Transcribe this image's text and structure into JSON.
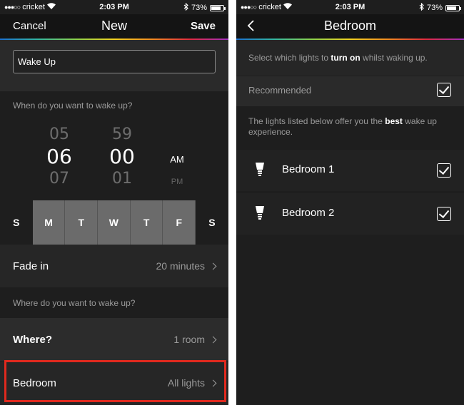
{
  "status": {
    "carrier": "cricket",
    "time": "2:03 PM",
    "battery": "73%"
  },
  "left": {
    "nav": {
      "cancel": "Cancel",
      "title": "New",
      "save": "Save"
    },
    "name_value": "Wake Up",
    "time_question": "When do you want to wake up?",
    "picker": {
      "hour_prev": "05",
      "hour": "06",
      "hour_next": "07",
      "minute_prev": "59",
      "minute": "00",
      "minute_next": "01",
      "am": "AM",
      "pm": "PM"
    },
    "days": [
      {
        "label": "S",
        "selected": false
      },
      {
        "label": "M",
        "selected": true
      },
      {
        "label": "T",
        "selected": true
      },
      {
        "label": "W",
        "selected": true
      },
      {
        "label": "T",
        "selected": true
      },
      {
        "label": "F",
        "selected": true
      },
      {
        "label": "S",
        "selected": false
      }
    ],
    "fade": {
      "label": "Fade in",
      "value": "20 minutes"
    },
    "place_question": "Where do you want to wake up?",
    "where": {
      "label": "Where?",
      "value": "1 room"
    },
    "room": {
      "label": "Bedroom",
      "value": "All lights"
    }
  },
  "right": {
    "nav": {
      "title": "Bedroom"
    },
    "instruction": {
      "pre": "Select which lights to ",
      "bold": "turn on",
      "post": " whilst waking up."
    },
    "recommended": "Recommended",
    "note": {
      "pre": "The lights listed below offer you the ",
      "bold": "best",
      "post": " wake up experience."
    },
    "lights": [
      {
        "name": "Bedroom 1",
        "checked": true
      },
      {
        "name": "Bedroom 2",
        "checked": true
      }
    ]
  },
  "colors": {
    "highlight": "#e0291e",
    "background": "#1e1e1e",
    "selected_day": "#6b6b6b"
  }
}
